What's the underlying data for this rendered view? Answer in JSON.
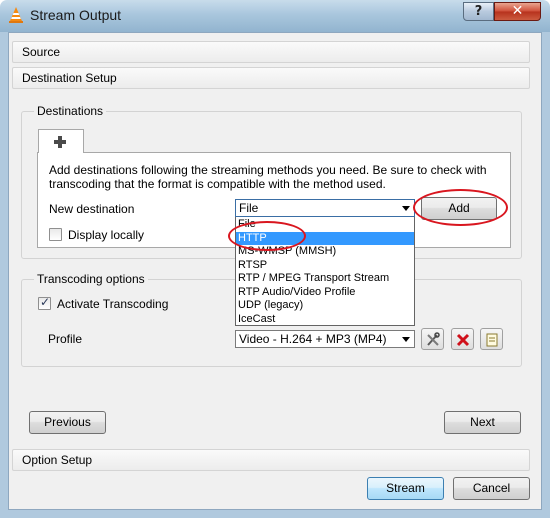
{
  "window": {
    "title": "Stream Output",
    "help_label": "?",
    "close_label": "✕",
    "icon": "vlc-cone-icon"
  },
  "sections": {
    "source": "Source",
    "destination_setup": "Destination Setup",
    "option_setup": "Option Setup"
  },
  "destinations": {
    "group_title": "Destinations",
    "tab_icon": "plus-icon",
    "description_line1": "Add destinations following the streaming methods you need. Be sure to check with",
    "description_line2": "transcoding that the format is compatible with the method used.",
    "new_destination_label": "New destination",
    "selected_destination": "File",
    "add_label": "Add",
    "display_locally_label": "Display locally",
    "display_locally_checked": false,
    "dropdown_options": [
      "File",
      "HTTP",
      "MS-WMSP (MMSH)",
      "RTSP",
      "RTP / MPEG Transport Stream",
      "RTP Audio/Video Profile",
      "UDP (legacy)",
      "IceCast"
    ],
    "highlighted_option": "HTTP"
  },
  "transcoding": {
    "group_title": "Transcoding options",
    "activate_label": "Activate Transcoding",
    "activate_checked": true,
    "profile_label": "Profile",
    "profile_value": "Video - H.264 + MP3 (MP4)",
    "profile_buttons": [
      "edit-profile-icon",
      "delete-profile-icon",
      "new-profile-icon"
    ]
  },
  "navigation": {
    "previous_label": "Previous",
    "next_label": "Next"
  },
  "footer": {
    "stream_label": "Stream",
    "cancel_label": "Cancel"
  },
  "colors": {
    "selection": "#3399ff",
    "annotation": "#d9161f",
    "titlebar": "#a9c6dd"
  }
}
